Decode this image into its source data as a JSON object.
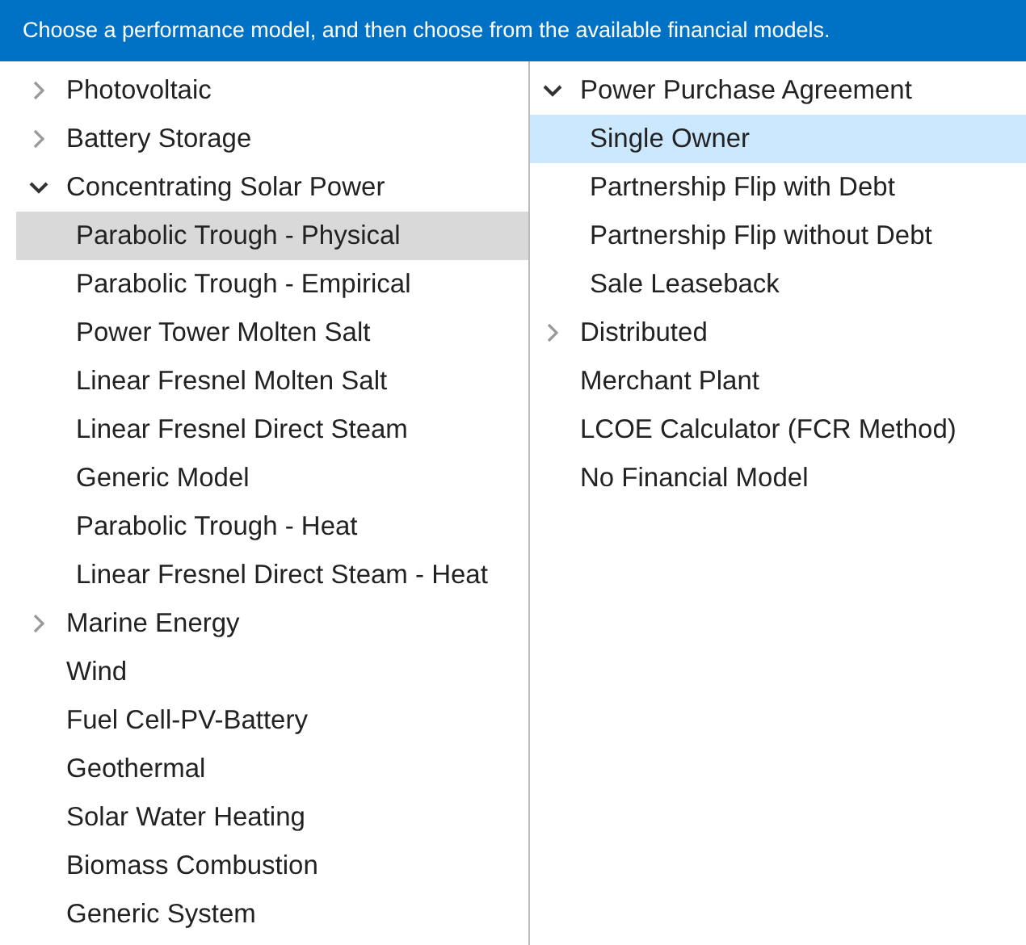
{
  "header": "Choose a performance model, and then choose from the available financial models.",
  "performance_models": [
    {
      "kind": "group",
      "label": "Photovoltaic",
      "expanded": false
    },
    {
      "kind": "group",
      "label": "Battery Storage",
      "expanded": false
    },
    {
      "kind": "group",
      "label": "Concentrating Solar Power",
      "expanded": true,
      "children": [
        {
          "kind": "model",
          "label": "Parabolic Trough - Physical",
          "selected": true
        },
        {
          "kind": "model",
          "label": "Parabolic Trough - Empirical",
          "selected": false
        },
        {
          "kind": "model",
          "label": "Power Tower Molten Salt",
          "selected": false
        },
        {
          "kind": "model",
          "label": "Linear Fresnel Molten Salt",
          "selected": false
        },
        {
          "kind": "model",
          "label": "Linear Fresnel Direct Steam",
          "selected": false
        },
        {
          "kind": "model",
          "label": "Generic Model",
          "selected": false
        },
        {
          "kind": "model",
          "label": "Parabolic Trough - Heat",
          "selected": false
        },
        {
          "kind": "model",
          "label": "Linear Fresnel Direct Steam - Heat",
          "selected": false
        }
      ]
    },
    {
      "kind": "group",
      "label": "Marine Energy",
      "expanded": false
    },
    {
      "kind": "model",
      "label": "Wind",
      "selected": false
    },
    {
      "kind": "model",
      "label": "Fuel Cell-PV-Battery",
      "selected": false
    },
    {
      "kind": "model",
      "label": "Geothermal",
      "selected": false
    },
    {
      "kind": "model",
      "label": "Solar Water Heating",
      "selected": false
    },
    {
      "kind": "model",
      "label": "Biomass Combustion",
      "selected": false
    },
    {
      "kind": "model",
      "label": "Generic System",
      "selected": false
    }
  ],
  "financial_models": [
    {
      "kind": "group",
      "label": "Power Purchase Agreement",
      "expanded": true,
      "children": [
        {
          "kind": "model",
          "label": "Single Owner",
          "selected": true
        },
        {
          "kind": "model",
          "label": "Partnership Flip with Debt",
          "selected": false
        },
        {
          "kind": "model",
          "label": "Partnership Flip without Debt",
          "selected": false
        },
        {
          "kind": "model",
          "label": "Sale Leaseback",
          "selected": false
        }
      ]
    },
    {
      "kind": "group",
      "label": "Distributed",
      "expanded": false
    },
    {
      "kind": "model",
      "label": "Merchant Plant",
      "selected": false
    },
    {
      "kind": "model",
      "label": "LCOE Calculator (FCR Method)",
      "selected": false
    },
    {
      "kind": "model",
      "label": "No Financial Model",
      "selected": false
    }
  ]
}
